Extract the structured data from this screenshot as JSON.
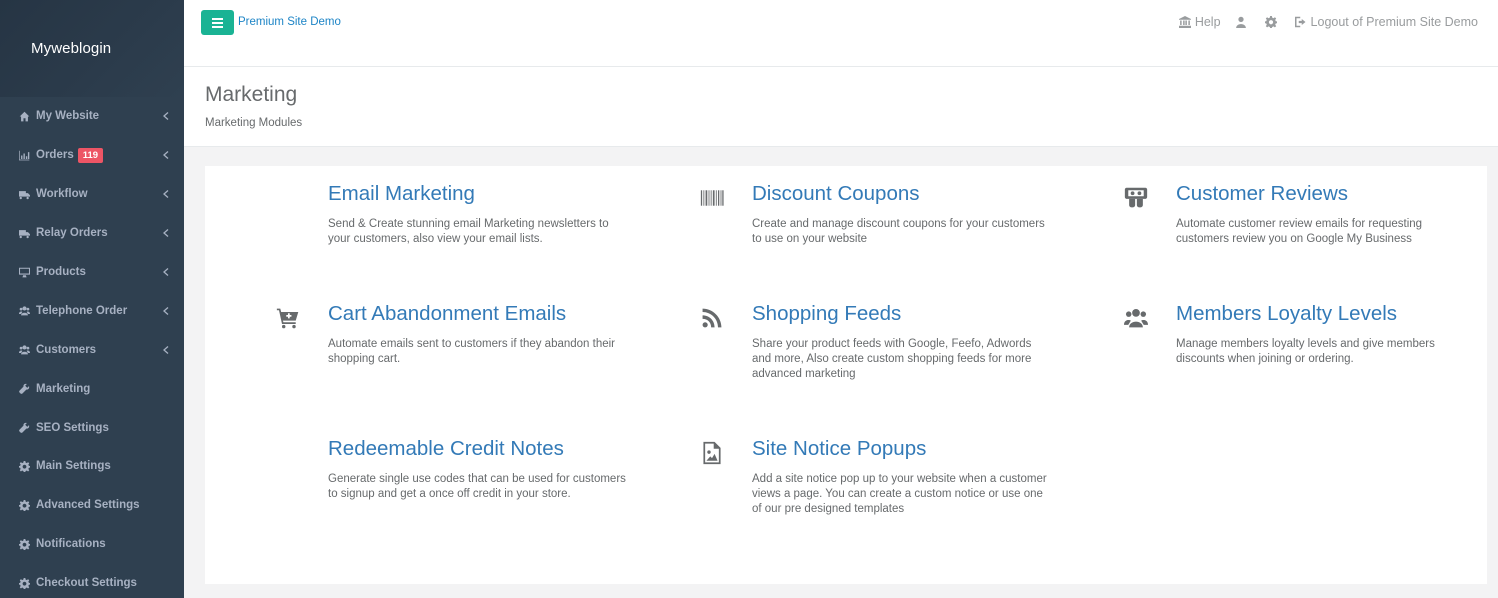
{
  "sidebar": {
    "brand": "Myweblogin",
    "items": [
      {
        "label": "My Website",
        "icon": "home-icon",
        "chevron": true
      },
      {
        "label": "Orders",
        "icon": "bar-chart-icon",
        "chevron": true,
        "badge": "119"
      },
      {
        "label": "Workflow",
        "icon": "truck-icon",
        "chevron": true
      },
      {
        "label": "Relay Orders",
        "icon": "truck-icon",
        "chevron": true
      },
      {
        "label": "Products",
        "icon": "desktop-icon",
        "chevron": true
      },
      {
        "label": "Telephone Order",
        "icon": "users-icon",
        "chevron": true
      },
      {
        "label": "Customers",
        "icon": "users-icon",
        "chevron": true
      },
      {
        "label": "Marketing",
        "icon": "wrench-icon",
        "chevron": false
      },
      {
        "label": "SEO Settings",
        "icon": "wrench-icon",
        "chevron": false
      },
      {
        "label": "Main Settings",
        "icon": "gear-icon",
        "chevron": false
      },
      {
        "label": "Advanced Settings",
        "icon": "gear-icon",
        "chevron": false
      },
      {
        "label": "Notifications",
        "icon": "gear-icon",
        "chevron": false
      },
      {
        "label": "Checkout Settings",
        "icon": "gear-icon",
        "chevron": false
      }
    ]
  },
  "topbar": {
    "site_name": "Premium Site Demo",
    "help_label": "Help",
    "logout_label": "Logout of Premium Site Demo",
    "accent_color": "#1ab394"
  },
  "heading": {
    "title": "Marketing",
    "subtitle": "Marketing Modules"
  },
  "modules": [
    {
      "title": "Email Marketing",
      "icon": "none",
      "desc": "Send & Create stunning email Marketing newsletters to your customers, also view your email lists."
    },
    {
      "title": "Discount Coupons",
      "icon": "barcode-icon",
      "desc": "Create and manage discount coupons for your customers to use on your website"
    },
    {
      "title": "Customer Reviews",
      "icon": "reviews-icon",
      "desc": "Automate customer review emails for requesting customers review you on Google My Business"
    },
    {
      "title": "Cart Abandonment Emails",
      "icon": "cart-plus-icon",
      "desc": "Automate emails sent to customers if they abandon their shopping cart."
    },
    {
      "title": "Shopping Feeds",
      "icon": "rss-icon",
      "desc": "Share your product feeds with Google, Feefo, Adwords and more, Also create custom shopping feeds for more advanced marketing"
    },
    {
      "title": "Members Loyalty Levels",
      "icon": "users-icon",
      "desc": "Manage members loyalty levels and give members discounts when joining or ordering."
    },
    {
      "title": "Redeemable Credit Notes",
      "icon": "none",
      "desc": "Generate single use codes that can be used for customers to signup and get a once off credit in your store."
    },
    {
      "title": "Site Notice Popups",
      "icon": "image-file-icon",
      "desc": "Add a site notice pop up to your website when a customer views a page. You can create a custom notice or use one of our pre designed templates"
    }
  ]
}
